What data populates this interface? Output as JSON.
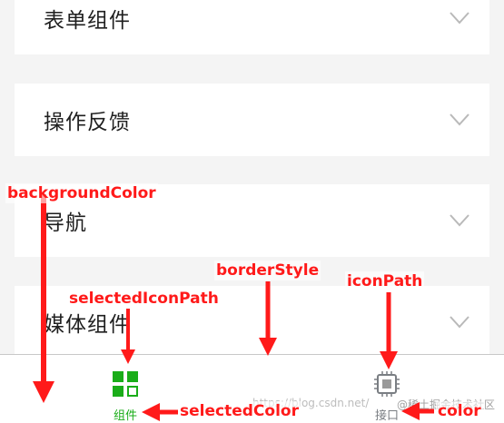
{
  "menu": {
    "items": [
      {
        "label": "表单组件"
      },
      {
        "label": "操作反馈"
      },
      {
        "label": "导航"
      },
      {
        "label": "媒体组件"
      }
    ]
  },
  "tabbar": {
    "tabs": [
      {
        "label": "组件",
        "icon": "grid-icon",
        "selected": true
      },
      {
        "label": "接口",
        "icon": "chip-icon",
        "selected": false
      }
    ]
  },
  "colors": {
    "selected": "#1aad19",
    "unselected": "#7a7e83",
    "annotation": "#ff1a1a",
    "background": "#f4f4f4"
  },
  "annotations": {
    "backgroundColor": "backgroundColor",
    "borderStyle": "borderStyle",
    "iconPath": "iconPath",
    "selectedIconPath": "selectedIconPath",
    "selectedColor": "selectedColor",
    "color": "color"
  },
  "watermark": {
    "left": "https://blog.csdn.net/",
    "right": "@稀土掘金技术社区"
  }
}
